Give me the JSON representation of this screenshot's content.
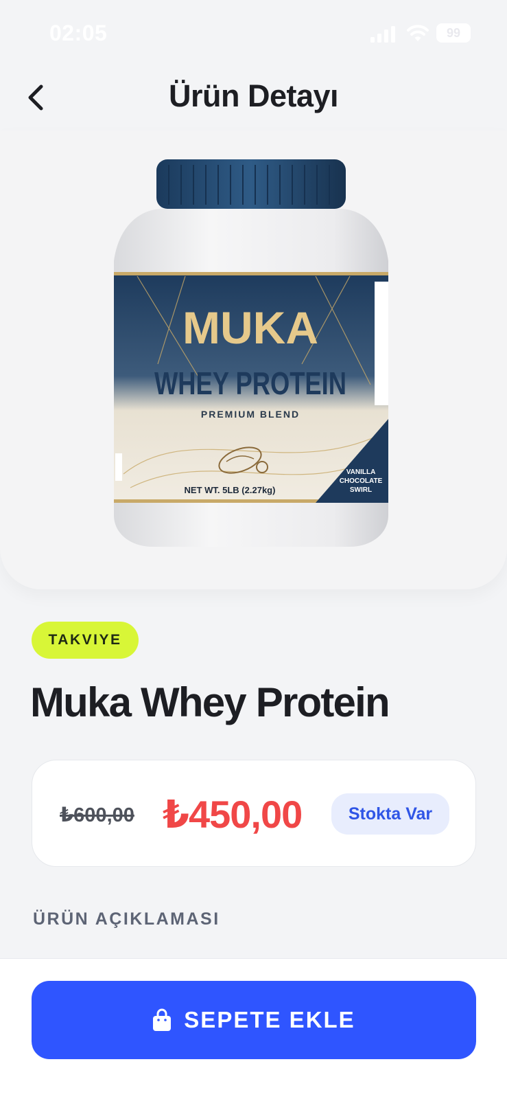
{
  "status_bar": {
    "time": "02:05",
    "battery": "99"
  },
  "header": {
    "title": "Ürün Detayı"
  },
  "product": {
    "image_label": {
      "brand": "MUKA",
      "line": "WHEY PROTEIN",
      "blend": "PREMIUM BLEND",
      "net_weight": "NET WT. 5LB (2.27kg)",
      "flavor_1": "VANILLA",
      "flavor_2": "CHOCOLATE",
      "flavor_3": "SWIRL"
    },
    "category": "TAKVIYE",
    "name": "Muka Whey Protein",
    "old_price": "₺600,00",
    "price": "₺450,00",
    "stock_status": "Stokta Var",
    "description_heading": "ÜRÜN AÇIKLAMASI"
  },
  "actions": {
    "add_to_cart": "SEPETE EKLE"
  },
  "colors": {
    "accent": "#2f55ff",
    "chip": "#d8f637",
    "price_red": "#f04747",
    "background": "#f3f4f6"
  }
}
